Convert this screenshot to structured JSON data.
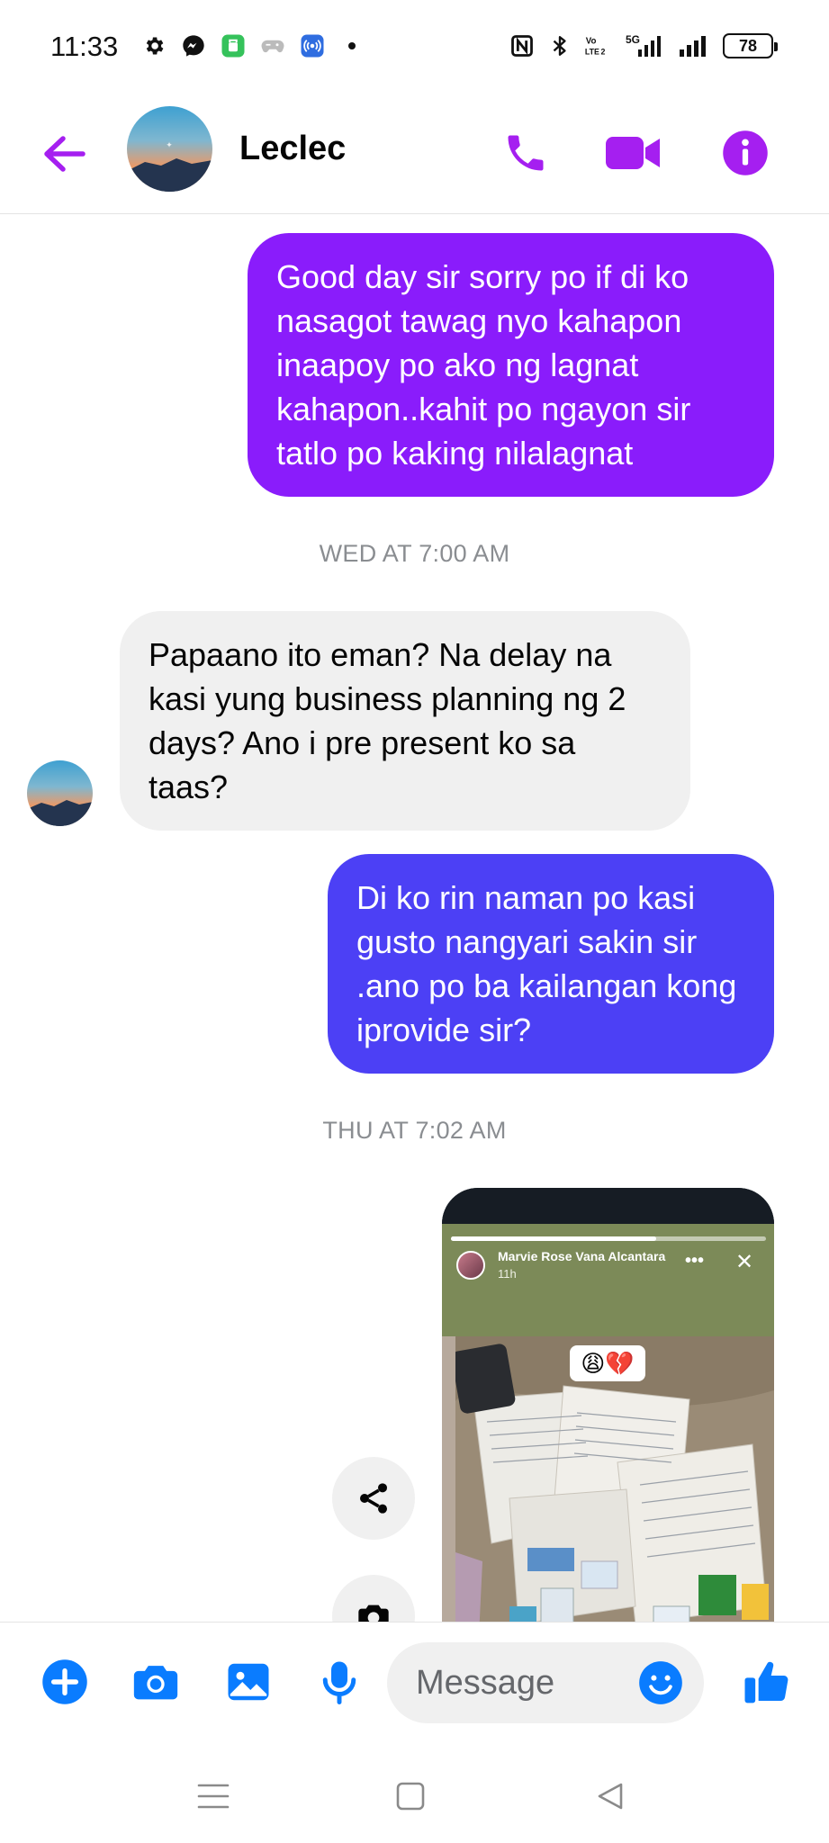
{
  "status_bar": {
    "time": "11:33",
    "battery": "78",
    "network": "5G",
    "left_icons": [
      "gear-icon",
      "messenger-icon",
      "app-icon",
      "gamepad-icon",
      "hotspot-icon",
      "dot-icon"
    ],
    "right_icons": [
      "nfc-icon",
      "bluetooth-icon",
      "volte-icon",
      "signal-icon",
      "signal-icon",
      "battery-icon"
    ]
  },
  "header": {
    "contact_name": "Leclec",
    "icons": [
      "back-arrow-icon",
      "phone-icon",
      "video-icon",
      "info-icon"
    ]
  },
  "colors": {
    "accent": "#a51ff0",
    "outgoing_1": "#8a1cfb",
    "outgoing_2": "#4c40f5",
    "incoming": "#f0f0f0",
    "composer_icon": "#0a7cff"
  },
  "messages": [
    {
      "direction": "outgoing",
      "text": "Good day sir sorry po if di ko nasagot tawag nyo kahapon inaapoy po ako ng lagnat kahapon..kahit po ngayon sir tatlo po kaking nilalagnat"
    },
    {
      "direction": "incoming",
      "text": "Papaano ito eman? Na delay na kasi yung business planning ng 2 days? Ano i pre present ko sa taas?"
    },
    {
      "direction": "outgoing",
      "text": "Di ko rin naman po kasi gusto nangyari sakin sir .ano po ba kailangan kong iprovide sir?"
    }
  ],
  "timestamps": [
    "WED AT 7:00 AM",
    "THU AT 7:02 AM"
  ],
  "story": {
    "name": "Marvie Rose Vana Alcantara",
    "time": "11h",
    "progress": 0.65,
    "sticker": "😩💔"
  },
  "composer": {
    "placeholder": "Message",
    "icons": [
      "plus-icon",
      "camera-icon",
      "gallery-icon",
      "microphone-icon",
      "emoji-icon",
      "thumbs-up-icon"
    ]
  },
  "navbar": {
    "icons": [
      "menu-icon",
      "home-icon",
      "back-icon"
    ]
  }
}
